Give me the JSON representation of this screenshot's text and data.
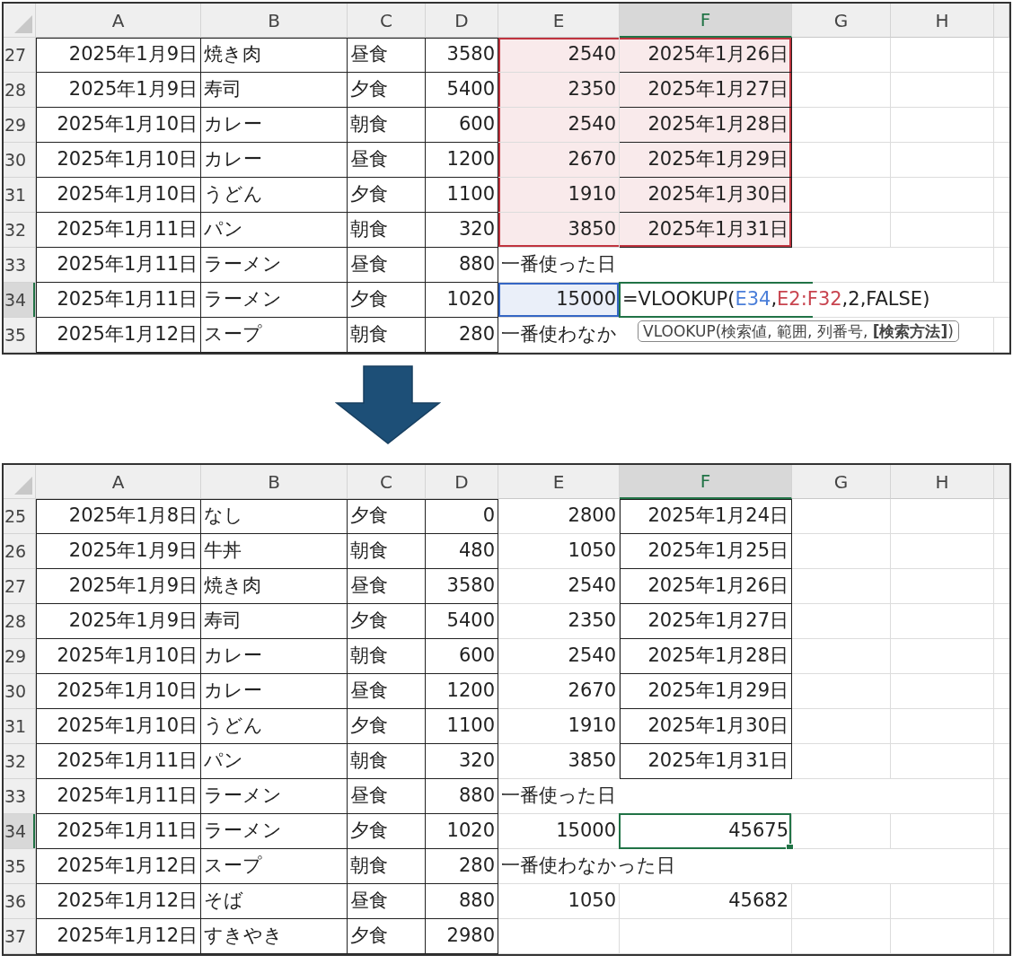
{
  "sheets": [
    {
      "columns": [
        {
          "label": "A",
          "selected": false
        },
        {
          "label": "B",
          "selected": false
        },
        {
          "label": "C",
          "selected": false
        },
        {
          "label": "D",
          "selected": false
        },
        {
          "label": "E",
          "selected": false
        },
        {
          "label": "F",
          "selected": true
        },
        {
          "label": "G",
          "selected": false
        },
        {
          "label": "H",
          "selected": false
        }
      ],
      "rows": [
        {
          "number": "27",
          "selected": false,
          "cells": [
            {
              "text": "2025年1月9日",
              "kind": "number",
              "bordered": true
            },
            {
              "text": "焼き肉",
              "kind": "text",
              "bordered": true
            },
            {
              "text": "昼食",
              "kind": "text",
              "bordered": true
            },
            {
              "text": "3580",
              "kind": "number",
              "bordered": true
            },
            {
              "text": "2540",
              "kind": "number",
              "color": "#c0343f"
            },
            {
              "text": "2025年1月26日",
              "kind": "number",
              "bordered": true,
              "color": "#c0343f"
            },
            null,
            null
          ]
        },
        {
          "number": "28",
          "selected": false,
          "cells": [
            {
              "text": "2025年1月9日",
              "kind": "number",
              "bordered": true
            },
            {
              "text": "寿司",
              "kind": "text",
              "bordered": true
            },
            {
              "text": "夕食",
              "kind": "text",
              "bordered": true
            },
            {
              "text": "5400",
              "kind": "number",
              "bordered": true
            },
            {
              "text": "2350",
              "kind": "number",
              "color": "#c0343f"
            },
            {
              "text": "2025年1月27日",
              "kind": "number",
              "bordered": true,
              "color": "#c0343f"
            },
            null,
            null
          ]
        },
        {
          "number": "29",
          "selected": false,
          "cells": [
            {
              "text": "2025年1月10日",
              "kind": "number",
              "bordered": true
            },
            {
              "text": "カレー",
              "kind": "text",
              "bordered": true
            },
            {
              "text": "朝食",
              "kind": "text",
              "bordered": true
            },
            {
              "text": "600",
              "kind": "number",
              "bordered": true
            },
            {
              "text": "2540",
              "kind": "number",
              "color": "#c0343f"
            },
            {
              "text": "2025年1月28日",
              "kind": "number",
              "bordered": true,
              "color": "#c0343f"
            },
            null,
            null
          ]
        },
        {
          "number": "30",
          "selected": false,
          "cells": [
            {
              "text": "2025年1月10日",
              "kind": "number",
              "bordered": true
            },
            {
              "text": "カレー",
              "kind": "text",
              "bordered": true
            },
            {
              "text": "昼食",
              "kind": "text",
              "bordered": true
            },
            {
              "text": "1200",
              "kind": "number",
              "bordered": true
            },
            {
              "text": "2670",
              "kind": "number",
              "color": "#c0343f"
            },
            {
              "text": "2025年1月29日",
              "kind": "number",
              "bordered": true,
              "color": "#c0343f"
            },
            null,
            null
          ]
        },
        {
          "number": "31",
          "selected": false,
          "cells": [
            {
              "text": "2025年1月10日",
              "kind": "number",
              "bordered": true
            },
            {
              "text": "うどん",
              "kind": "text",
              "bordered": true
            },
            {
              "text": "夕食",
              "kind": "text",
              "bordered": true
            },
            {
              "text": "1100",
              "kind": "number",
              "bordered": true
            },
            {
              "text": "1910",
              "kind": "number",
              "color": "#c0343f"
            },
            {
              "text": "2025年1月30日",
              "kind": "number",
              "bordered": true,
              "color": "#c0343f"
            },
            null,
            null
          ]
        },
        {
          "number": "32",
          "selected": false,
          "cells": [
            {
              "text": "2025年1月11日",
              "kind": "number",
              "bordered": true
            },
            {
              "text": "パン",
              "kind": "text",
              "bordered": true
            },
            {
              "text": "朝食",
              "kind": "text",
              "bordered": true
            },
            {
              "text": "320",
              "kind": "number",
              "bordered": true
            },
            {
              "text": "3850",
              "kind": "number",
              "color": "#c0343f"
            },
            {
              "text": "2025年1月31日",
              "kind": "number",
              "bordered": true,
              "color": "#c0343f"
            },
            null,
            null
          ]
        },
        {
          "number": "33",
          "selected": false,
          "cells": [
            {
              "text": "2025年1月11日",
              "kind": "number",
              "bordered": true
            },
            {
              "text": "ラーメン",
              "kind": "text",
              "bordered": true
            },
            {
              "text": "昼食",
              "kind": "text",
              "bordered": true
            },
            {
              "text": "880",
              "kind": "number",
              "bordered": true
            },
            {
              "text": "一番使った日",
              "kind": "text"
            },
            null,
            null,
            null
          ]
        },
        {
          "number": "34",
          "selected": true,
          "cells": [
            {
              "text": "2025年1月11日",
              "kind": "number",
              "bordered": true
            },
            {
              "text": "ラーメン",
              "kind": "text",
              "bordered": true
            },
            {
              "text": "夕食",
              "kind": "text",
              "bordered": true
            },
            {
              "text": "1020",
              "kind": "number",
              "bordered": true
            },
            {
              "text": "15000",
              "kind": "number",
              "color": "#3566c4"
            },
            {
              "kind": "formula",
              "parts": [
                {
                  "text": "=VLOOKUP("
                },
                {
                  "text": "E34",
                  "color": "#4a7ed9"
                },
                {
                  "text": ","
                },
                {
                  "text": "E2:F32",
                  "color": "#c8444f"
                },
                {
                  "text": ",2,FALSE)"
                }
              ]
            },
            null,
            null
          ]
        },
        {
          "number": "35",
          "selected": false,
          "cells": [
            {
              "text": "2025年1月12日",
              "kind": "number",
              "bordered": true
            },
            {
              "text": "スープ",
              "kind": "text",
              "bordered": true
            },
            {
              "text": "朝食",
              "kind": "text",
              "bordered": true
            },
            {
              "text": "280",
              "kind": "number",
              "bordered": true
            },
            {
              "text": "一番使わなか",
              "kind": "text"
            },
            null,
            null,
            null
          ]
        }
      ],
      "tooltip": {
        "text": "VLOOKUP(検索値, 範囲, 列番号, **[検索方法]**)"
      }
    },
    {
      "columns": [
        {
          "label": "A",
          "selected": false
        },
        {
          "label": "B",
          "selected": false
        },
        {
          "label": "C",
          "selected": false
        },
        {
          "label": "D",
          "selected": false
        },
        {
          "label": "E",
          "selected": false
        },
        {
          "label": "F",
          "selected": true
        },
        {
          "label": "G",
          "selected": false
        },
        {
          "label": "H",
          "selected": false
        }
      ],
      "rows": [
        {
          "number": "25",
          "selected": false,
          "cells": [
            {
              "text": "2025年1月8日",
              "kind": "number",
              "bordered": true
            },
            {
              "text": "なし",
              "kind": "text",
              "bordered": true
            },
            {
              "text": "夕食",
              "kind": "text",
              "bordered": true
            },
            {
              "text": "0",
              "kind": "number",
              "bordered": true
            },
            {
              "text": "2800",
              "kind": "number"
            },
            {
              "text": "2025年1月24日",
              "kind": "number",
              "bordered": true
            },
            null,
            null
          ]
        },
        {
          "number": "26",
          "selected": false,
          "cells": [
            {
              "text": "2025年1月9日",
              "kind": "number",
              "bordered": true
            },
            {
              "text": "牛丼",
              "kind": "text",
              "bordered": true
            },
            {
              "text": "朝食",
              "kind": "text",
              "bordered": true
            },
            {
              "text": "480",
              "kind": "number",
              "bordered": true
            },
            {
              "text": "1050",
              "kind": "number"
            },
            {
              "text": "2025年1月25日",
              "kind": "number",
              "bordered": true
            },
            null,
            null
          ]
        },
        {
          "number": "27",
          "selected": false,
          "cells": [
            {
              "text": "2025年1月9日",
              "kind": "number",
              "bordered": true
            },
            {
              "text": "焼き肉",
              "kind": "text",
              "bordered": true
            },
            {
              "text": "昼食",
              "kind": "text",
              "bordered": true
            },
            {
              "text": "3580",
              "kind": "number",
              "bordered": true
            },
            {
              "text": "2540",
              "kind": "number"
            },
            {
              "text": "2025年1月26日",
              "kind": "number",
              "bordered": true
            },
            null,
            null
          ]
        },
        {
          "number": "28",
          "selected": false,
          "cells": [
            {
              "text": "2025年1月9日",
              "kind": "number",
              "bordered": true
            },
            {
              "text": "寿司",
              "kind": "text",
              "bordered": true
            },
            {
              "text": "夕食",
              "kind": "text",
              "bordered": true
            },
            {
              "text": "5400",
              "kind": "number",
              "bordered": true
            },
            {
              "text": "2350",
              "kind": "number"
            },
            {
              "text": "2025年1月27日",
              "kind": "number",
              "bordered": true
            },
            null,
            null
          ]
        },
        {
          "number": "29",
          "selected": false,
          "cells": [
            {
              "text": "2025年1月10日",
              "kind": "number",
              "bordered": true
            },
            {
              "text": "カレー",
              "kind": "text",
              "bordered": true
            },
            {
              "text": "朝食",
              "kind": "text",
              "bordered": true
            },
            {
              "text": "600",
              "kind": "number",
              "bordered": true
            },
            {
              "text": "2540",
              "kind": "number"
            },
            {
              "text": "2025年1月28日",
              "kind": "number",
              "bordered": true
            },
            null,
            null
          ]
        },
        {
          "number": "30",
          "selected": false,
          "cells": [
            {
              "text": "2025年1月10日",
              "kind": "number",
              "bordered": true
            },
            {
              "text": "カレー",
              "kind": "text",
              "bordered": true
            },
            {
              "text": "昼食",
              "kind": "text",
              "bordered": true
            },
            {
              "text": "1200",
              "kind": "number",
              "bordered": true
            },
            {
              "text": "2670",
              "kind": "number"
            },
            {
              "text": "2025年1月29日",
              "kind": "number",
              "bordered": true
            },
            null,
            null
          ]
        },
        {
          "number": "31",
          "selected": false,
          "cells": [
            {
              "text": "2025年1月10日",
              "kind": "number",
              "bordered": true
            },
            {
              "text": "うどん",
              "kind": "text",
              "bordered": true
            },
            {
              "text": "夕食",
              "kind": "text",
              "bordered": true
            },
            {
              "text": "1100",
              "kind": "number",
              "bordered": true
            },
            {
              "text": "1910",
              "kind": "number"
            },
            {
              "text": "2025年1月30日",
              "kind": "number",
              "bordered": true
            },
            null,
            null
          ]
        },
        {
          "number": "32",
          "selected": false,
          "cells": [
            {
              "text": "2025年1月11日",
              "kind": "number",
              "bordered": true
            },
            {
              "text": "パン",
              "kind": "text",
              "bordered": true
            },
            {
              "text": "朝食",
              "kind": "text",
              "bordered": true
            },
            {
              "text": "320",
              "kind": "number",
              "bordered": true
            },
            {
              "text": "3850",
              "kind": "number"
            },
            {
              "text": "2025年1月31日",
              "kind": "number",
              "bordered": true
            },
            null,
            null
          ]
        },
        {
          "number": "33",
          "selected": false,
          "cells": [
            {
              "text": "2025年1月11日",
              "kind": "number",
              "bordered": true
            },
            {
              "text": "ラーメン",
              "kind": "text",
              "bordered": true
            },
            {
              "text": "昼食",
              "kind": "text",
              "bordered": true
            },
            {
              "text": "880",
              "kind": "number",
              "bordered": true
            },
            {
              "text": "一番使った日",
              "kind": "text"
            },
            null,
            null,
            null
          ]
        },
        {
          "number": "34",
          "selected": true,
          "cells": [
            {
              "text": "2025年1月11日",
              "kind": "number",
              "bordered": true
            },
            {
              "text": "ラーメン",
              "kind": "text",
              "bordered": true
            },
            {
              "text": "夕食",
              "kind": "text",
              "bordered": true
            },
            {
              "text": "1020",
              "kind": "number",
              "bordered": true
            },
            {
              "text": "15000",
              "kind": "number"
            },
            {
              "text": "45675",
              "kind": "number"
            },
            null,
            null
          ]
        },
        {
          "number": "35",
          "selected": false,
          "cells": [
            {
              "text": "2025年1月12日",
              "kind": "number",
              "bordered": true
            },
            {
              "text": "スープ",
              "kind": "text",
              "bordered": true
            },
            {
              "text": "朝食",
              "kind": "text",
              "bordered": true
            },
            {
              "text": "280",
              "kind": "number",
              "bordered": true
            },
            {
              "text": "一番使わなかった日",
              "kind": "text"
            },
            null,
            null,
            null
          ]
        },
        {
          "number": "36",
          "selected": false,
          "cells": [
            {
              "text": "2025年1月12日",
              "kind": "number",
              "bordered": true
            },
            {
              "text": "そば",
              "kind": "text",
              "bordered": true
            },
            {
              "text": "昼食",
              "kind": "text",
              "bordered": true
            },
            {
              "text": "880",
              "kind": "number",
              "bordered": true
            },
            {
              "text": "1050",
              "kind": "number"
            },
            {
              "text": "45682",
              "kind": "number"
            },
            null,
            null
          ]
        },
        {
          "number": "37",
          "selected": false,
          "cells": [
            {
              "text": "2025年1月12日",
              "kind": "number",
              "bordered": true
            },
            {
              "text": "すきやき",
              "kind": "text",
              "bordered": true
            },
            {
              "text": "夕食",
              "kind": "text",
              "bordered": true
            },
            {
              "text": "2980",
              "kind": "number",
              "bordered": true
            },
            null,
            null,
            null,
            null
          ]
        }
      ]
    }
  ]
}
